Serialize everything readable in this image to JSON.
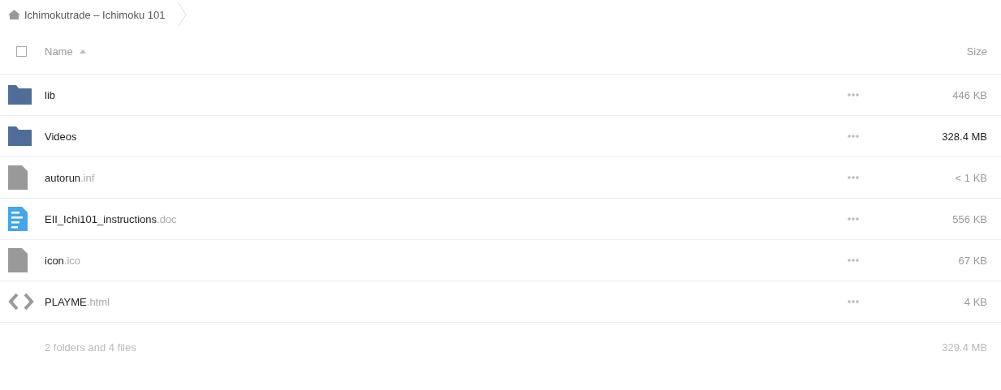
{
  "breadcrumb": {
    "label": "Ichimokutrade – Ichimoku 101"
  },
  "table": {
    "header": {
      "checked": false,
      "name": "Name",
      "size": "Size"
    },
    "rows": [
      {
        "kind": "folder",
        "name": "lib",
        "size": "446 KB",
        "emphasized": false
      },
      {
        "kind": "folder",
        "name": "Videos",
        "size": "328.4 MB",
        "emphasized": true
      },
      {
        "kind": "file",
        "name": "autorun",
        "extension": ".inf",
        "size": "< 1 KB",
        "emphasized": false
      },
      {
        "kind": "document",
        "name": "EII_Ichi101_instructions",
        "extension": ".doc",
        "size": "556 KB",
        "emphasized": false
      },
      {
        "kind": "file",
        "name": "icon",
        "extension": ".ico",
        "size": "67 KB",
        "emphasized": false
      },
      {
        "kind": "code",
        "name": "PLAYME",
        "extension": ".html",
        "size": "4 KB",
        "emphasized": false
      }
    ],
    "summary": {
      "count": "2 folders and 4 files",
      "size": "329.4 MB"
    }
  }
}
